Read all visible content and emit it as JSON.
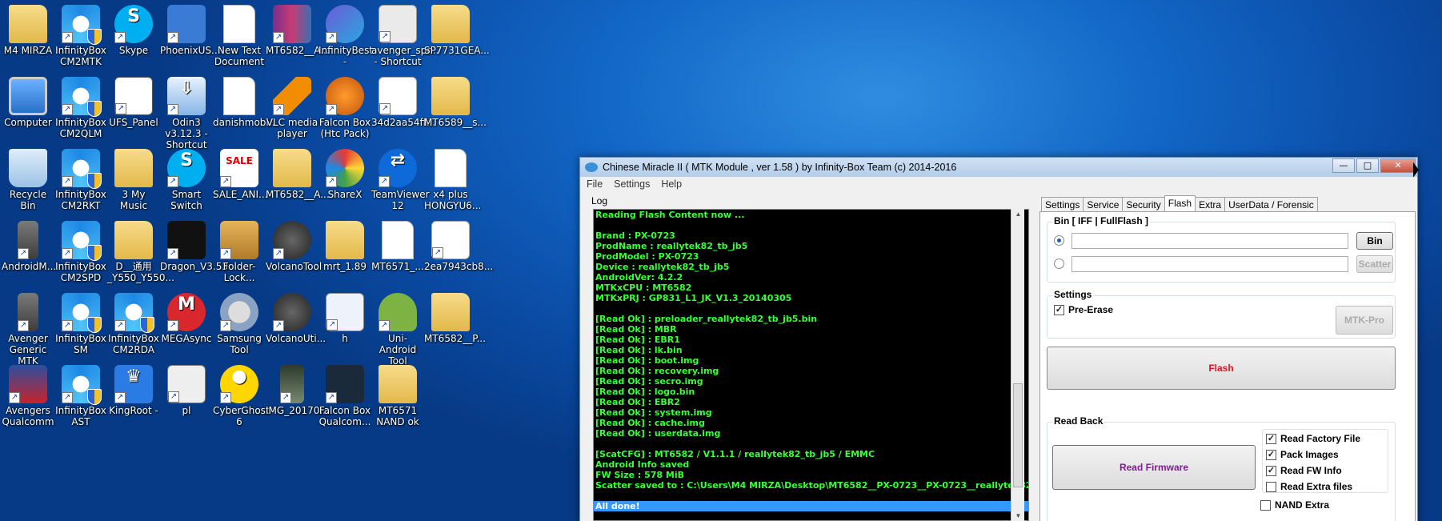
{
  "desktop": {
    "icons": [
      {
        "label": "M4 MIRZA",
        "icon": "user-folder-icon",
        "kind": "folder"
      },
      {
        "label": "InfinityBox CM2MTK",
        "icon": "infinitybox-icon",
        "kind": "ib"
      },
      {
        "label": "Skype",
        "icon": "skype-icon",
        "kind": "skype"
      },
      {
        "label": "PhoenixUS...",
        "icon": "phoenix-icon",
        "kind": "phoenix"
      },
      {
        "label": "New Text Document",
        "icon": "text-document-icon",
        "kind": "doc"
      },
      {
        "label": "MT6582__A...",
        "icon": "winrar-archive-icon",
        "kind": "rar"
      },
      {
        "label": "InfinityBest -",
        "icon": "infinitybest-icon",
        "kind": "ibest"
      },
      {
        "label": "avenger_spr... - Shortcut",
        "icon": "shortcut-app-icon",
        "kind": "app"
      },
      {
        "label": "SP7731GEA...",
        "icon": "folder-icon",
        "kind": "folder"
      },
      {
        "label": "Computer",
        "icon": "computer-icon",
        "kind": "computer"
      },
      {
        "label": "InfinityBox CM2QLM",
        "icon": "infinitybox-icon",
        "kind": "ib"
      },
      {
        "label": "UFS_Panel",
        "icon": "ufs-panel-icon",
        "kind": "ufs"
      },
      {
        "label": "Odin3 v3.12.3 - Shortcut",
        "icon": "odin-icon",
        "kind": "odin"
      },
      {
        "label": "danishmobi...",
        "icon": "document-icon",
        "kind": "doc"
      },
      {
        "label": "VLC media player",
        "icon": "vlc-icon",
        "kind": "vlc"
      },
      {
        "label": "Falcon Box (Htc Pack)",
        "icon": "falcon-box-icon",
        "kind": "falcon"
      },
      {
        "label": "34d2aa54ff...",
        "icon": "torrent-file-icon",
        "kind": "torrent"
      },
      {
        "label": "MT6589__s...",
        "icon": "folder-icon",
        "kind": "folder"
      },
      {
        "label": "Recycle Bin",
        "icon": "recycle-bin-icon",
        "kind": "bin"
      },
      {
        "label": "InfinityBox CM2RKT",
        "icon": "infinitybox-icon",
        "kind": "ib"
      },
      {
        "label": "3 My Music",
        "icon": "folder-icon",
        "kind": "folder"
      },
      {
        "label": "Smart Switch",
        "icon": "smart-switch-icon",
        "kind": "skype"
      },
      {
        "label": "SALE_ANI...",
        "icon": "sale-image-icon",
        "kind": "sale"
      },
      {
        "label": "MT6582__A...",
        "icon": "folder-icon",
        "kind": "folder"
      },
      {
        "label": "ShareX",
        "icon": "sharex-icon",
        "kind": "sharex"
      },
      {
        "label": "TeamViewer 12",
        "icon": "teamviewer-icon",
        "kind": "tv"
      },
      {
        "label": "x4 plus HONGYU6...",
        "icon": "document-icon",
        "kind": "doc"
      },
      {
        "label": "AndroidM...",
        "icon": "android-phone-icon",
        "kind": "phone"
      },
      {
        "label": "InfinityBox CM2SPD",
        "icon": "infinitybox-icon",
        "kind": "ib"
      },
      {
        "label": "D__通用 _Y550_Y550...",
        "icon": "folder-icon",
        "kind": "folder"
      },
      {
        "label": "Dragon_V3.53",
        "icon": "dragon-icon",
        "kind": "dragon"
      },
      {
        "label": "Folder-Lock...",
        "icon": "folder-lock-icon",
        "kind": "flock"
      },
      {
        "label": "VolcanoTool",
        "icon": "volcano-icon",
        "kind": "volcano"
      },
      {
        "label": "mrt_1.89",
        "icon": "folder-icon",
        "kind": "folder"
      },
      {
        "label": "MT6571_...",
        "icon": "document-icon",
        "kind": "doc"
      },
      {
        "label": "2ea7943cb8...",
        "icon": "torrent-file-icon",
        "kind": "torrent"
      },
      {
        "label": "Avenger Generic MTK",
        "icon": "avenger-phone-icon",
        "kind": "phone"
      },
      {
        "label": "InfinityBox SM",
        "icon": "infinitybox-icon",
        "kind": "ib"
      },
      {
        "label": "InfinityBox CM2RDA",
        "icon": "infinitybox-icon",
        "kind": "ib"
      },
      {
        "label": "MEGAsync",
        "icon": "megasync-icon",
        "kind": "mega"
      },
      {
        "label": "Samsung Tool",
        "icon": "samsung-tool-icon",
        "kind": "gear"
      },
      {
        "label": "VolcanoUti...",
        "icon": "volcano-icon",
        "kind": "volcano"
      },
      {
        "label": "h",
        "icon": "window-file-icon",
        "kind": "hwin"
      },
      {
        "label": "Uni-Android Tool",
        "icon": "android-icon",
        "kind": "android"
      },
      {
        "label": "MT6582__P...",
        "icon": "folder-icon",
        "kind": "folder"
      },
      {
        "label": "Avengers Qualcomm",
        "icon": "avengers-icon",
        "kind": "avengers"
      },
      {
        "label": "InfinityBox AST",
        "icon": "infinitybox-icon",
        "kind": "ib"
      },
      {
        "label": "KingRoot -",
        "icon": "kingroot-icon",
        "kind": "king"
      },
      {
        "label": "pl",
        "icon": "android-file-icon",
        "kind": "pl"
      },
      {
        "label": "CyberGhost 6",
        "icon": "cyberghost-icon",
        "kind": "ghost"
      },
      {
        "label": "IMG_20170...",
        "icon": "image-file-icon",
        "kind": "img"
      },
      {
        "label": "Falcon Box Qualcom...",
        "icon": "falcon-box-icon",
        "kind": "falcon2"
      },
      {
        "label": "MT6571 NAND ok",
        "icon": "folder-icon",
        "kind": "folder"
      }
    ]
  },
  "window": {
    "title": "Chinese Miracle II ( MTK Module , ver 1.58 ) by Infinity-Box Team (c) 2014-2016",
    "controls": {
      "min": "—",
      "max": "□",
      "close": "✕"
    },
    "menu": [
      "File",
      "Settings",
      "Help"
    ],
    "log_label": "Log",
    "log_lines": [
      "Reading Flash Content now ...",
      "",
      "Brand    : PX-0723",
      "ProdName : reallytek82_tb_jb5",
      "ProdModel : PX-0723",
      "Device   : reallytek82_tb_jb5",
      "AndroidVer: 4.2.2",
      "MTKxCPU  : MT6582",
      "MTKxPRJ  : GP831_L1_JK_V1.3_20140305",
      "",
      "[Read Ok] : preloader_reallytek82_tb_jb5.bin",
      "[Read Ok] : MBR",
      "[Read Ok] : EBR1",
      "[Read Ok] : lk.bin",
      "[Read Ok] : boot.img",
      "[Read Ok] : recovery.img",
      "[Read Ok] : secro.img",
      "[Read Ok] : logo.bin",
      "[Read Ok] : EBR2",
      "[Read Ok] : system.img",
      "[Read Ok] : cache.img",
      "[Read Ok] : userdata.img",
      "",
      "[ScatCFG] : MT6582 / V1.1.1 / reallytek82_tb_jb5 / EMMC",
      "Android Info saved",
      "FW Size : 578 MiB",
      "Scatter saved to : C:\\Users\\M4 MIRZA\\Desktop\\MT6582__PX-0723__PX-0723__reallytek82",
      ""
    ],
    "log_done": "All done!",
    "tabs": [
      "Settings",
      "Service",
      "Security",
      "Flash",
      "Extra",
      "UserData / Forensic"
    ],
    "active_tab": "Flash",
    "bin_group": {
      "title": "Bin  [ IFF | FullFlash ]",
      "bin_button": "Bin",
      "scatter_button": "Scatter",
      "bin_path": "",
      "scatter_path": ""
    },
    "settings_group": {
      "title": "Settings",
      "pre_erase": "Pre-Erase",
      "pre_erase_checked": true,
      "mtk_pro_button": "MTK-Pro"
    },
    "flash_button": "Flash",
    "readback_group": {
      "title": "Read Back",
      "read_firmware_button": "Read Firmware",
      "options": [
        {
          "label": "Read Factory File",
          "checked": true
        },
        {
          "label": "Pack Images",
          "checked": true
        },
        {
          "label": "Read FW Info",
          "checked": true
        },
        {
          "label": "Read Extra files",
          "checked": false
        }
      ],
      "nand_extra": "NAND Extra",
      "nand_extra_checked": false
    },
    "colors": {
      "log_text": "#37ff37",
      "flash_text": "#d9161b",
      "read_fw_text": "#7a1f8c",
      "done_bg": "#3399ff"
    }
  }
}
